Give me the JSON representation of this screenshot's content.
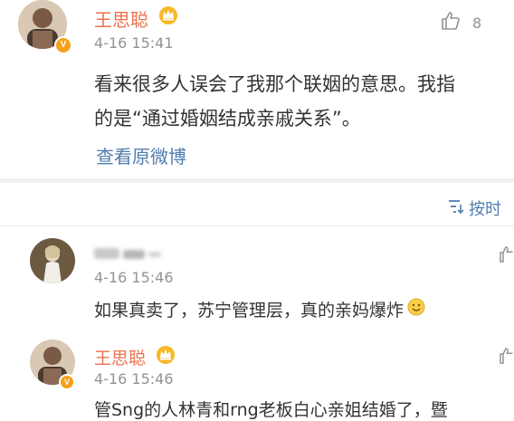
{
  "post": {
    "username": "王思聪",
    "time": "4-16 15:41",
    "likes": "8",
    "content_line1": "看来很多人误会了我那个联姻的意思。我指",
    "content_line2": "的是“通过婚姻结成亲戚关系”。",
    "view_original": "查看原微博"
  },
  "sort": {
    "label": "按时"
  },
  "comments": [
    {
      "username": "",
      "time": "4-16 15:46",
      "text": "如果真卖了，苏宁管理层，真的亲妈爆炸"
    },
    {
      "username": "王思聪",
      "time": "4-16 15:46",
      "text": "管Sng的人林青和rng老板白心亲姐结婚了，暨"
    }
  ],
  "icons": {
    "like": "thumbs-up-icon",
    "sort": "sort-icon",
    "vip": "vip-crown-icon",
    "verified": "verified-v-icon",
    "smile": "smile-emoji-icon"
  }
}
